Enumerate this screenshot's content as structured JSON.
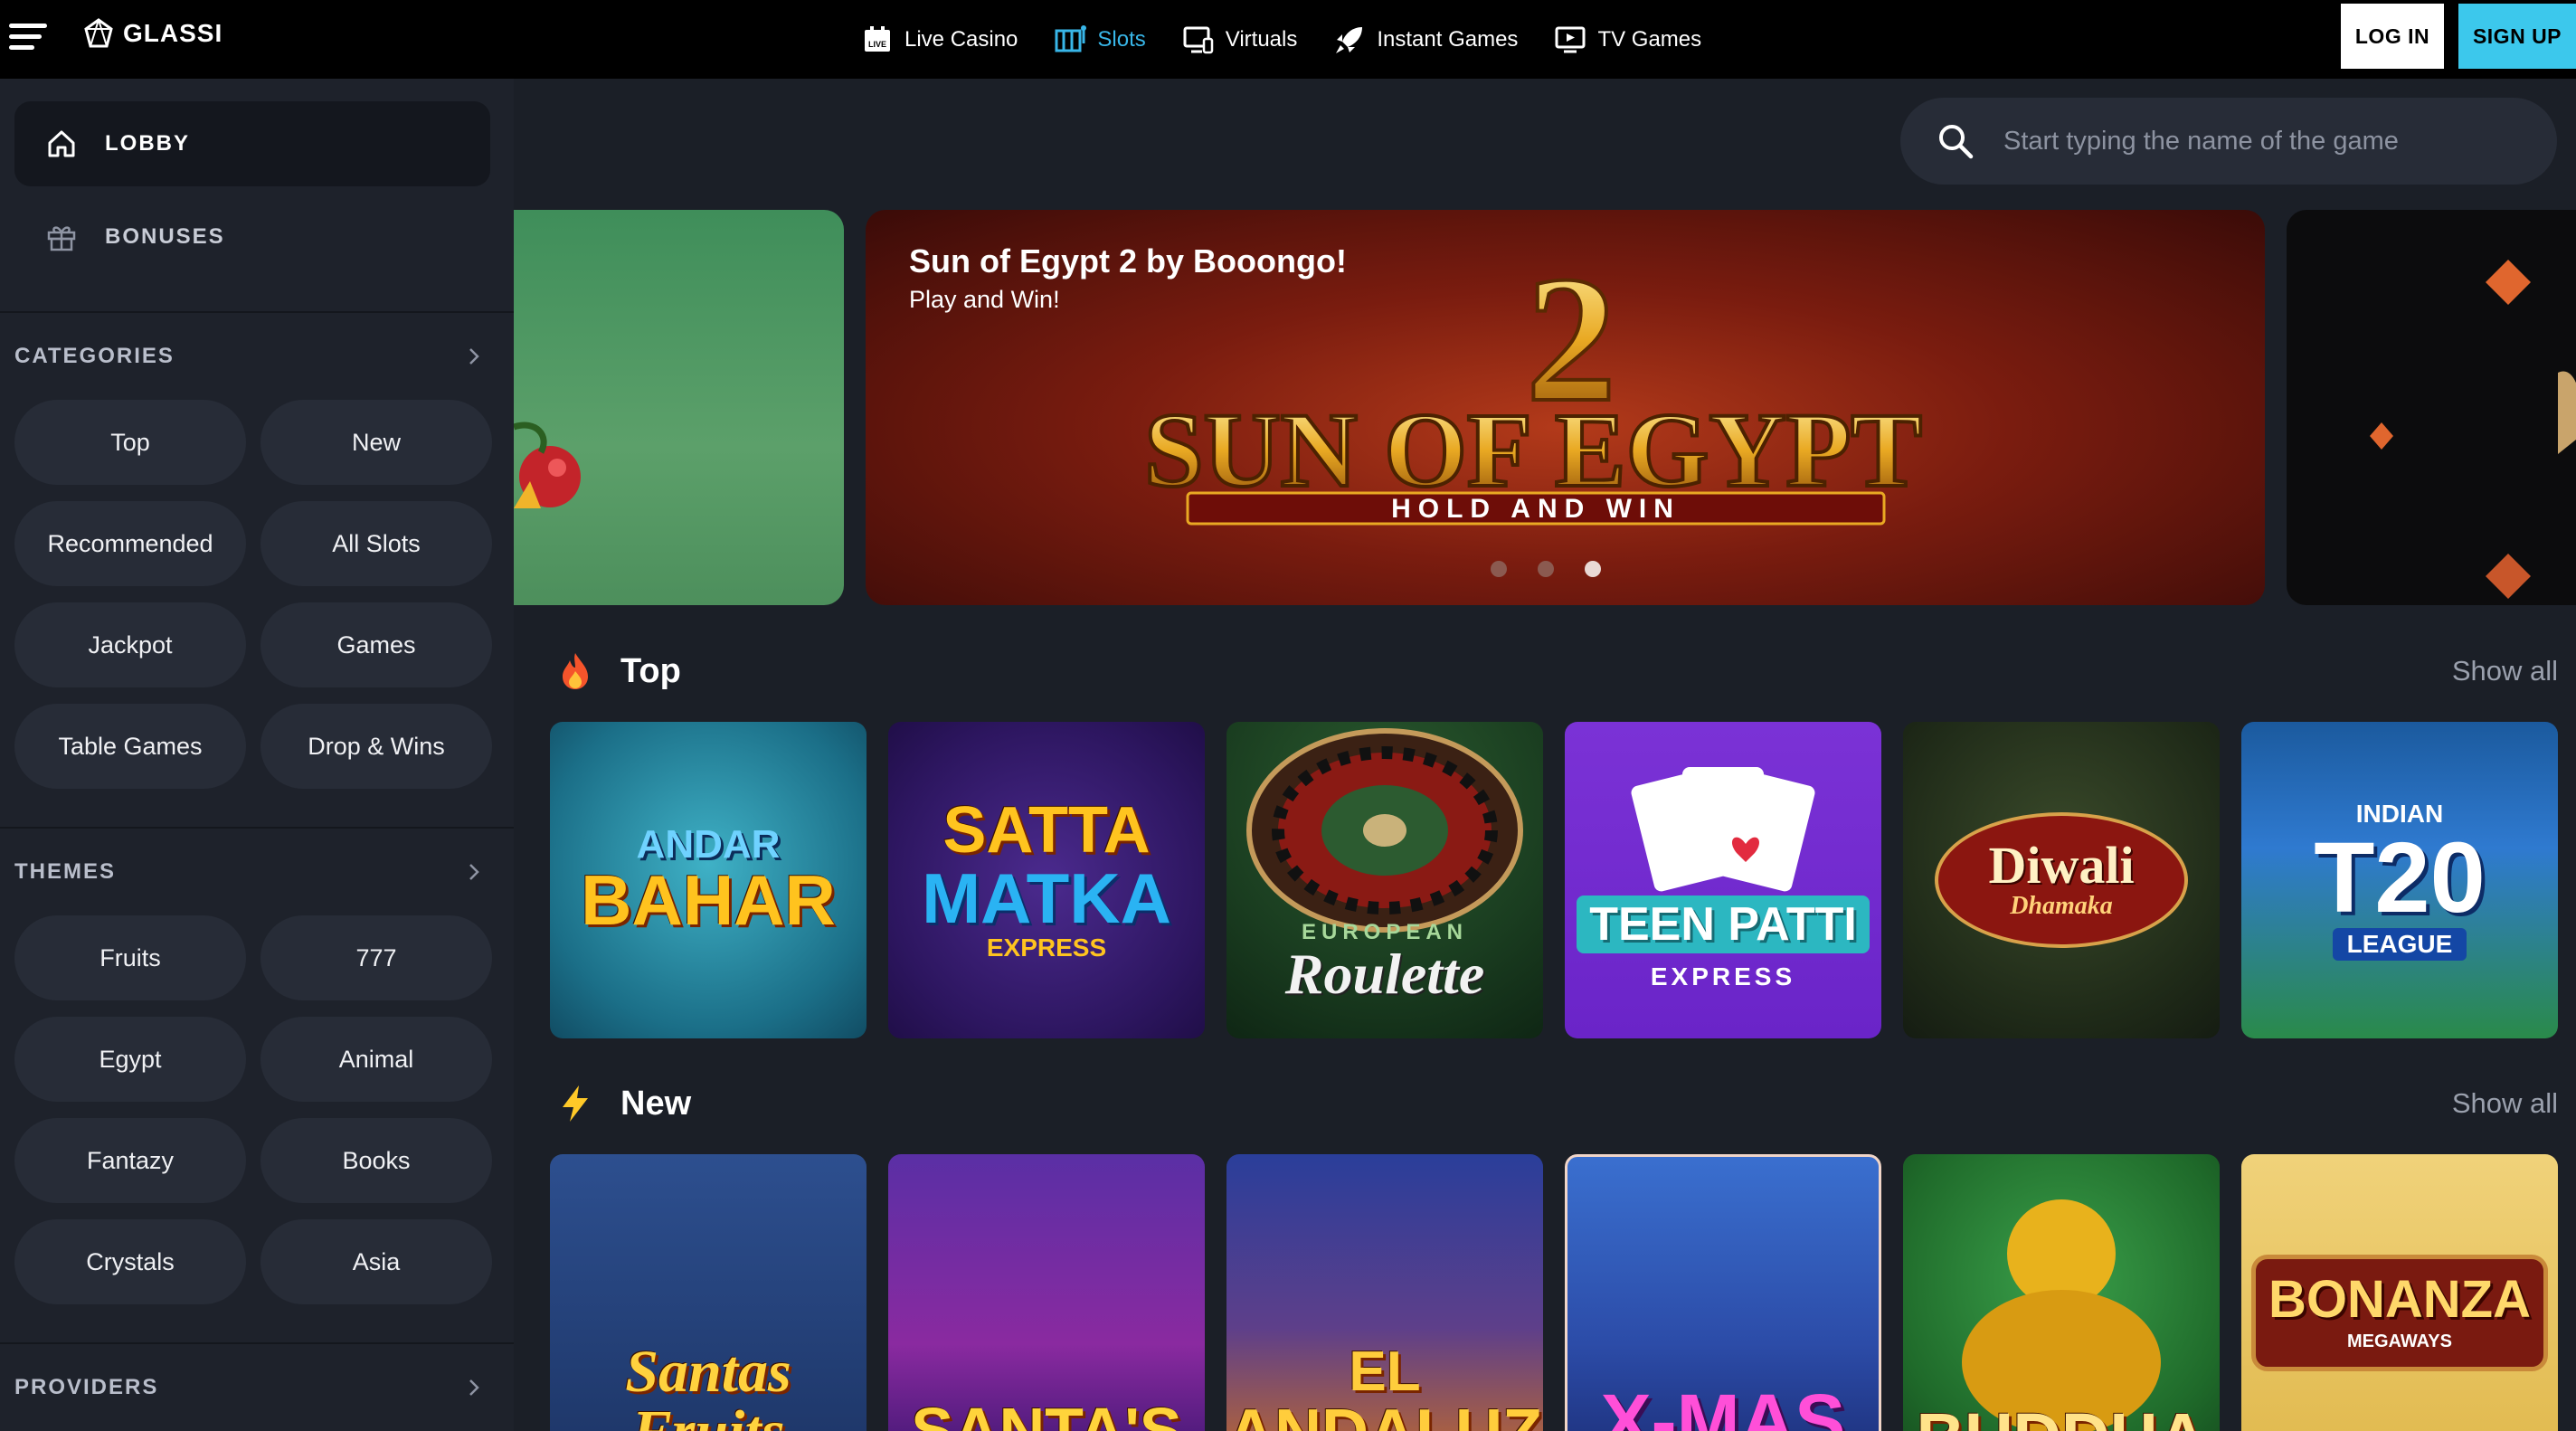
{
  "header": {
    "logo_text": "GLASSI",
    "nav": [
      {
        "label": "Live Casino",
        "icon": "live-casino-icon",
        "active": false
      },
      {
        "label": "Slots",
        "icon": "slots-icon",
        "active": true
      },
      {
        "label": "Virtuals",
        "icon": "virtuals-icon",
        "active": false
      },
      {
        "label": "Instant Games",
        "icon": "rocket-icon",
        "active": false
      },
      {
        "label": "TV Games",
        "icon": "tv-icon",
        "active": false
      }
    ],
    "login_label": "LOG IN",
    "signup_label": "SIGN UP",
    "colors": {
      "active_nav": "#38b6e8",
      "signup_bg": "#3cc8ec"
    }
  },
  "sidebar": {
    "links": [
      {
        "label": "LOBBY",
        "icon": "home-icon",
        "active": true
      },
      {
        "label": "BONUSES",
        "icon": "gift-icon",
        "active": false
      }
    ],
    "categories": {
      "title": "CATEGORIES",
      "items": [
        "Top",
        "New",
        "Recommended",
        "All Slots",
        "Jackpot",
        "Games",
        "Table Games",
        "Drop & Wins"
      ]
    },
    "themes": {
      "title": "THEMES",
      "items": [
        "Fruits",
        "777",
        "Egypt",
        "Animal",
        "Fantazy",
        "Books",
        "Crystals",
        "Asia"
      ]
    },
    "providers": {
      "title": "PROVIDERS"
    }
  },
  "search": {
    "placeholder": "Start typing the name of the game"
  },
  "banner": {
    "title": "Sun of Egypt 2 by Booongo!",
    "subtitle": "Play and Win!",
    "art": {
      "number": "2",
      "line1": "SUN OF EGYPT",
      "line2": "HOLD AND WIN"
    },
    "dots_total": 3,
    "dot_active": 3
  },
  "sections": {
    "top": {
      "title": "Top",
      "show_all": "Show all",
      "games": [
        {
          "line1": "ANDAR",
          "line2": "BAHAR"
        },
        {
          "line1": "SATTA",
          "line2": "MATKA",
          "line3": "EXPRESS"
        },
        {
          "line1": "EUROPEAN",
          "line2": "Roulette"
        },
        {
          "line1": "TEEN PATTI",
          "line2": "EXPRESS"
        },
        {
          "line1": "Diwali",
          "line2": "Dhamaka"
        },
        {
          "line1": "INDIAN",
          "line2": "T20",
          "line3": "LEAGUE"
        }
      ]
    },
    "new": {
      "title": "New",
      "show_all": "Show all",
      "games": [
        {
          "line1": "Santas",
          "line2": "Fruits"
        },
        {
          "line1": "SANTA'S"
        },
        {
          "line1": "EL",
          "line2": "ANDALUZ"
        },
        {
          "line1": "X-MAS"
        },
        {
          "line1": "BUDDHA"
        },
        {
          "line1": "BONANZA",
          "line2": "MEGAWAYS"
        }
      ]
    }
  }
}
